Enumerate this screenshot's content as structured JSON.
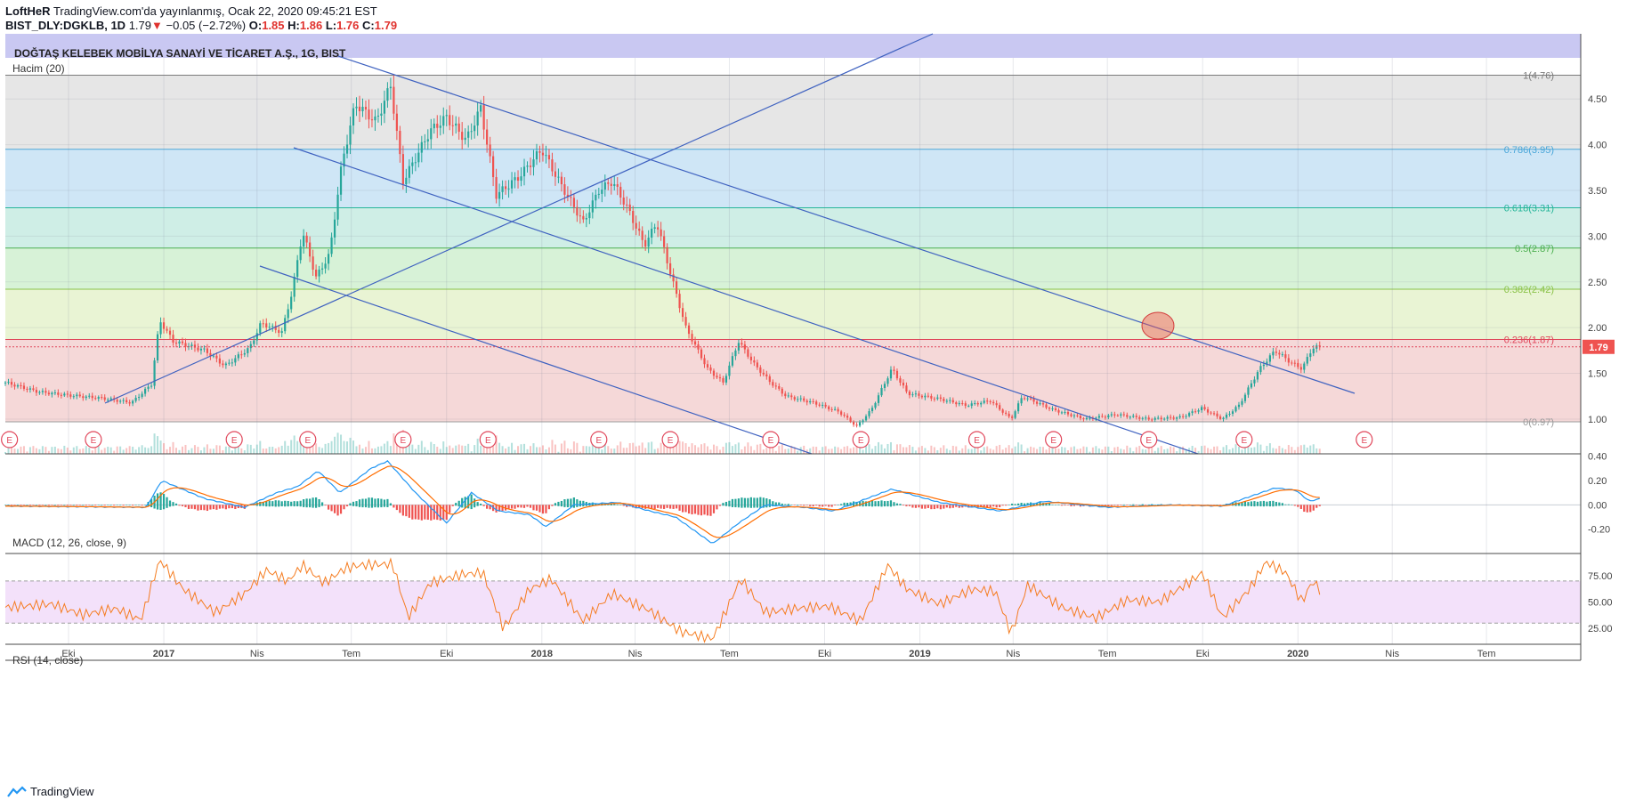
{
  "header": {
    "author": "LoftHeR",
    "published_text": "TradingView.com'da yayınlanmış, Ocak 22, 2020 09:45:21 EST",
    "symbol": "BIST_DLY:DGKLB, 1D",
    "last": "1.79",
    "change_arrow": "▼",
    "change": "−0.05 (−2.72%)",
    "o_label": "O:",
    "o_val": "1.85",
    "h_label": "H:",
    "h_val": "1.86",
    "l_label": "L:",
    "l_val": "1.76",
    "c_label": "C:",
    "c_val": "1.79"
  },
  "main_title": "DOĞTAŞ KELEBEK MOBİLYA SANAYİ VE TİCARET A.Ş., 1G, BIST",
  "volume_label": "Hacim (20)",
  "macd_label": "MACD (12, 26, close, 9)",
  "rsi_label": "RSI (14, close)",
  "last_price_tag": "1.79",
  "earnings_marker": "E",
  "branding": "TradingView",
  "colors": {
    "up": "#26a69a",
    "down": "#ef5350",
    "trend": "#3f62c0",
    "macd_line": "#2196f3",
    "signal_line": "#ff6d00",
    "rsi_line": "#f57c20",
    "rsi_band": "#f3e1fa"
  },
  "chart_data": [
    {
      "type": "candlestick",
      "title": "DOĞTAŞ KELEBEK MOBİLYA SANAYİ VE TİCARET A.Ş., 1G, BIST",
      "x_ticks": [
        "Eki",
        "2017",
        "Nis",
        "Tem",
        "Eki",
        "2018",
        "Nis",
        "Tem",
        "Eki",
        "2019",
        "Nis",
        "Tem",
        "Eki",
        "2020",
        "Nis",
        "Tem"
      ],
      "y_ticks": [
        "1.00",
        "1.50",
        "2.00",
        "2.50",
        "3.00",
        "3.50",
        "4.00",
        "4.50"
      ],
      "ylim": [
        0.62,
        4.95
      ],
      "date_range": [
        "2016-08-01",
        "2020-09-30"
      ],
      "price_path": [
        [
          "2016-08-01",
          1.4
        ],
        [
          "2016-09-01",
          1.3
        ],
        [
          "2016-10-01",
          1.26
        ],
        [
          "2016-11-01",
          1.23
        ],
        [
          "2016-12-01",
          1.18
        ],
        [
          "2016-12-20",
          1.38
        ],
        [
          "2016-12-28",
          2.08
        ],
        [
          "2017-01-10",
          1.85
        ],
        [
          "2017-02-10",
          1.75
        ],
        [
          "2017-03-01",
          1.58
        ],
        [
          "2017-03-25",
          1.78
        ],
        [
          "2017-04-05",
          2.05
        ],
        [
          "2017-04-25",
          1.95
        ],
        [
          "2017-05-05",
          2.4
        ],
        [
          "2017-05-15",
          3.05
        ],
        [
          "2017-05-28",
          2.55
        ],
        [
          "2017-06-10",
          2.8
        ],
        [
          "2017-06-22",
          3.8
        ],
        [
          "2017-07-05",
          4.45
        ],
        [
          "2017-07-25",
          4.25
        ],
        [
          "2017-08-08",
          4.65
        ],
        [
          "2017-08-20",
          3.6
        ],
        [
          "2017-09-15",
          4.15
        ],
        [
          "2017-10-01",
          4.3
        ],
        [
          "2017-10-20",
          4.05
        ],
        [
          "2017-11-03",
          4.4
        ],
        [
          "2017-11-18",
          3.45
        ],
        [
          "2017-12-10",
          3.65
        ],
        [
          "2018-01-01",
          3.95
        ],
        [
          "2018-01-20",
          3.55
        ],
        [
          "2018-02-10",
          3.15
        ],
        [
          "2018-02-25",
          3.5
        ],
        [
          "2018-03-10",
          3.6
        ],
        [
          "2018-03-25",
          3.3
        ],
        [
          "2018-04-10",
          2.9
        ],
        [
          "2018-04-22",
          3.15
        ],
        [
          "2018-05-05",
          2.6
        ],
        [
          "2018-05-20",
          2.0
        ],
        [
          "2018-06-10",
          1.55
        ],
        [
          "2018-06-25",
          1.4
        ],
        [
          "2018-07-10",
          1.85
        ],
        [
          "2018-07-25",
          1.6
        ],
        [
          "2018-08-10",
          1.4
        ],
        [
          "2018-08-25",
          1.25
        ],
        [
          "2018-09-20",
          1.18
        ],
        [
          "2018-10-15",
          1.08
        ],
        [
          "2018-11-01",
          0.92
        ],
        [
          "2018-11-15",
          1.1
        ],
        [
          "2018-12-05",
          1.55
        ],
        [
          "2018-12-20",
          1.28
        ],
        [
          "2019-01-20",
          1.22
        ],
        [
          "2019-02-15",
          1.15
        ],
        [
          "2019-03-10",
          1.2
        ],
        [
          "2019-03-30",
          1.0
        ],
        [
          "2019-04-10",
          1.25
        ],
        [
          "2019-05-10",
          1.1
        ],
        [
          "2019-06-10",
          1.0
        ],
        [
          "2019-07-10",
          1.05
        ],
        [
          "2019-08-10",
          1.0
        ],
        [
          "2019-09-10",
          1.02
        ],
        [
          "2019-09-30",
          1.12
        ],
        [
          "2019-10-20",
          1.0
        ],
        [
          "2019-11-05",
          1.15
        ],
        [
          "2019-11-25",
          1.55
        ],
        [
          "2019-12-10",
          1.75
        ],
        [
          "2019-12-25",
          1.62
        ],
        [
          "2020-01-05",
          1.55
        ],
        [
          "2020-01-15",
          1.78
        ],
        [
          "2020-01-22",
          1.79
        ]
      ],
      "fib_levels": [
        {
          "label": "1(4.76)",
          "value": 4.76
        },
        {
          "label": "0.786(3.95)",
          "value": 3.95
        },
        {
          "label": "0.618(3.31)",
          "value": 3.31
        },
        {
          "label": "0.5(2.87)",
          "value": 2.87
        },
        {
          "label": "0.382(2.42)",
          "value": 2.42
        },
        {
          "label": "0.236(1.87)",
          "value": 1.87
        },
        {
          "label": "0(0.97)",
          "value": 0.97
        }
      ],
      "earnings_dates": [
        "2016-08-05",
        "2016-10-25",
        "2017-03-10",
        "2017-05-20",
        "2017-08-20",
        "2017-11-10",
        "2018-02-25",
        "2018-05-05",
        "2018-08-10",
        "2018-11-05",
        "2019-02-25",
        "2019-05-10",
        "2019-08-10",
        "2019-11-10",
        "2020-03-05"
      ]
    },
    {
      "type": "bar",
      "title": "MACD (12, 26, close, 9)",
      "y_ticks": [
        "0.40",
        "0.20",
        "0.00",
        "-0.20"
      ],
      "ylim": [
        -0.4,
        0.42
      ],
      "macd_path": [
        [
          "2016-08-01",
          -0.01
        ],
        [
          "2016-12-15",
          -0.02
        ],
        [
          "2016-12-30",
          0.2
        ],
        [
          "2017-02-10",
          0.05
        ],
        [
          "2017-03-20",
          -0.02
        ],
        [
          "2017-04-20",
          0.1
        ],
        [
          "2017-05-10",
          0.15
        ],
        [
          "2017-05-30",
          0.28
        ],
        [
          "2017-06-20",
          0.1
        ],
        [
          "2017-07-20",
          0.3
        ],
        [
          "2017-08-05",
          0.36
        ],
        [
          "2017-09-01",
          0.1
        ],
        [
          "2017-10-01",
          -0.15
        ],
        [
          "2017-10-25",
          0.1
        ],
        [
          "2017-11-20",
          -0.05
        ],
        [
          "2017-12-20",
          -0.08
        ],
        [
          "2018-01-05",
          -0.18
        ],
        [
          "2018-02-01",
          0.0
        ],
        [
          "2018-03-15",
          0.02
        ],
        [
          "2018-04-15",
          -0.05
        ],
        [
          "2018-05-10",
          -0.1
        ],
        [
          "2018-06-15",
          -0.32
        ],
        [
          "2018-07-10",
          -0.15
        ],
        [
          "2018-08-05",
          0.0
        ],
        [
          "2018-09-10",
          -0.02
        ],
        [
          "2018-10-10",
          -0.05
        ],
        [
          "2018-12-05",
          0.13
        ],
        [
          "2019-01-20",
          0.02
        ],
        [
          "2019-03-20",
          -0.05
        ],
        [
          "2019-05-01",
          0.03
        ],
        [
          "2019-07-01",
          -0.02
        ],
        [
          "2019-09-01",
          0.0
        ],
        [
          "2019-10-20",
          -0.01
        ],
        [
          "2019-12-10",
          0.14
        ],
        [
          "2019-12-30",
          0.12
        ],
        [
          "2020-01-12",
          0.03
        ],
        [
          "2020-01-22",
          0.05
        ]
      ]
    },
    {
      "type": "line",
      "title": "RSI (14, close)",
      "y_ticks": [
        "75.00",
        "50.00",
        "25.00"
      ],
      "ylim": [
        10,
        96
      ],
      "band": [
        30,
        70
      ],
      "rsi_path": [
        [
          "2016-08-01",
          45
        ],
        [
          "2016-09-15",
          48
        ],
        [
          "2016-10-15",
          38
        ],
        [
          "2016-11-15",
          44
        ],
        [
          "2016-12-10",
          33
        ],
        [
          "2016-12-28",
          90
        ],
        [
          "2017-01-20",
          62
        ],
        [
          "2017-02-20",
          40
        ],
        [
          "2017-03-20",
          58
        ],
        [
          "2017-04-10",
          80
        ],
        [
          "2017-05-01",
          70
        ],
        [
          "2017-05-15",
          85
        ],
        [
          "2017-06-05",
          68
        ],
        [
          "2017-06-25",
          82
        ],
        [
          "2017-07-10",
          85
        ],
        [
          "2017-08-10",
          86
        ],
        [
          "2017-08-25",
          35
        ],
        [
          "2017-09-15",
          68
        ],
        [
          "2017-10-15",
          76
        ],
        [
          "2017-11-05",
          78
        ],
        [
          "2017-11-25",
          25
        ],
        [
          "2017-12-20",
          62
        ],
        [
          "2018-01-10",
          72
        ],
        [
          "2018-02-10",
          32
        ],
        [
          "2018-03-10",
          58
        ],
        [
          "2018-04-15",
          42
        ],
        [
          "2018-05-15",
          22
        ],
        [
          "2018-06-15",
          15
        ],
        [
          "2018-07-12",
          72
        ],
        [
          "2018-08-05",
          40
        ],
        [
          "2018-09-05",
          44
        ],
        [
          "2018-10-05",
          46
        ],
        [
          "2018-11-05",
          32
        ],
        [
          "2018-12-01",
          85
        ],
        [
          "2018-12-20",
          62
        ],
        [
          "2019-01-20",
          48
        ],
        [
          "2019-02-20",
          62
        ],
        [
          "2019-03-15",
          60
        ],
        [
          "2019-03-30",
          20
        ],
        [
          "2019-04-15",
          66
        ],
        [
          "2019-05-20",
          44
        ],
        [
          "2019-06-20",
          35
        ],
        [
          "2019-07-20",
          52
        ],
        [
          "2019-08-20",
          50
        ],
        [
          "2019-09-20",
          70
        ],
        [
          "2019-10-01",
          78
        ],
        [
          "2019-10-20",
          35
        ],
        [
          "2019-11-15",
          62
        ],
        [
          "2019-12-01",
          88
        ],
        [
          "2019-12-20",
          78
        ],
        [
          "2020-01-05",
          50
        ],
        [
          "2020-01-15",
          70
        ],
        [
          "2020-01-22",
          62
        ]
      ]
    }
  ]
}
